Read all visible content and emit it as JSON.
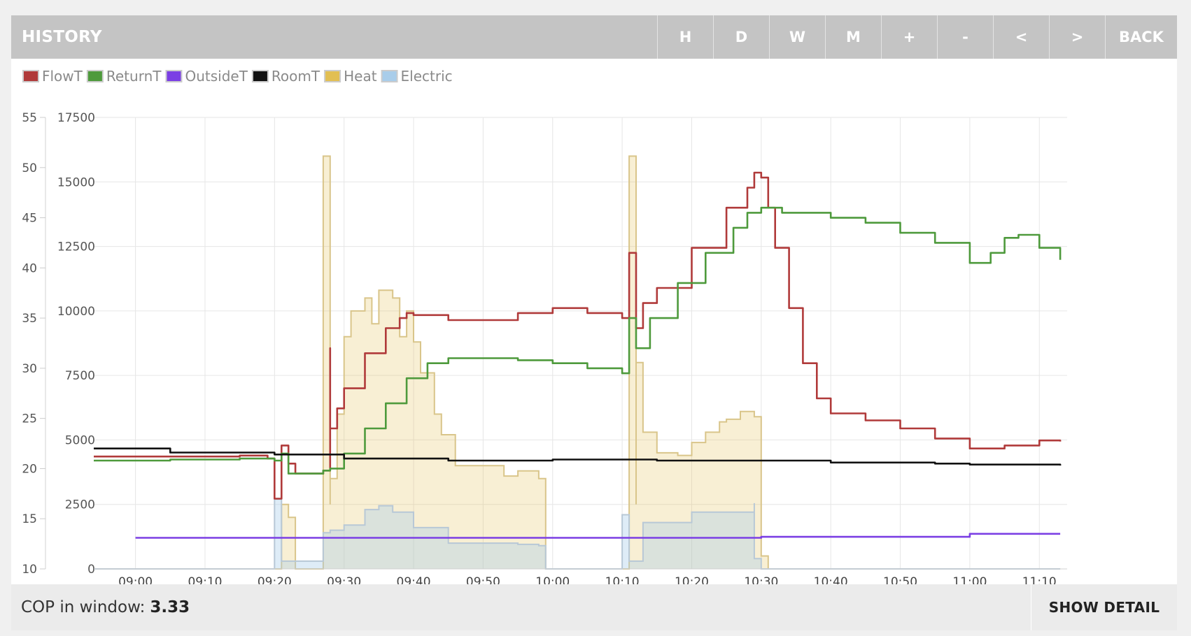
{
  "header": {
    "title": "HISTORY",
    "buttons": {
      "hour": "H",
      "day": "D",
      "week": "W",
      "month": "M",
      "zoom_in": "+",
      "zoom_out": "-",
      "prev": "<",
      "next": ">",
      "back": "BACK"
    }
  },
  "footer": {
    "cop_label": "COP in window:",
    "cop_value": "3.33",
    "detail_label": "SHOW DETAIL"
  },
  "chart_data": {
    "type": "line",
    "x_range": [
      "08:54",
      "11:14"
    ],
    "x_ticks": [
      "09:00",
      "09:10",
      "09:20",
      "09:30",
      "09:40",
      "09:50",
      "10:00",
      "10:10",
      "10:20",
      "10:30",
      "10:40",
      "10:50",
      "11:00",
      "11:10"
    ],
    "y_left": {
      "range": [
        10,
        55
      ],
      "ticks": [
        "10",
        "15",
        "20",
        "25",
        "30",
        "35",
        "40",
        "45",
        "50",
        "55"
      ]
    },
    "y_right": {
      "range": [
        0,
        17500
      ],
      "ticks": [
        "0",
        "2500",
        "5000",
        "7500",
        "10000",
        "12500",
        "15000",
        "17500"
      ]
    },
    "grid": true,
    "legend_position": "top-left",
    "series": [
      {
        "name": "FlowT",
        "axis": "left",
        "color": "#b03a3a",
        "x": [
          "08:54",
          "09:05",
          "09:15",
          "09:19",
          "09:20",
          "09:21",
          "09:22",
          "09:23",
          "09:26",
          "09:27",
          "09:28",
          "09:28",
          "09:29",
          "09:30",
          "09:33",
          "09:36",
          "09:38",
          "09:39",
          "09:40",
          "09:45",
          "09:50",
          "09:55",
          "10:00",
          "10:05",
          "10:10",
          "10:11",
          "10:11",
          "10:12",
          "10:13",
          "10:15",
          "10:20",
          "10:25",
          "10:28",
          "10:29",
          "10:30",
          "10:31",
          "10:32",
          "10:34",
          "10:36",
          "10:38",
          "10:40",
          "10:45",
          "10:50",
          "10:55",
          "11:00",
          "11:05",
          "11:10",
          "11:13"
        ],
        "y": [
          21.2,
          21.2,
          21.3,
          21.0,
          17.0,
          22.3,
          20.5,
          19.5,
          19.5,
          19.8,
          32.0,
          24.0,
          26.0,
          28.0,
          31.5,
          34.0,
          35.0,
          35.5,
          35.3,
          34.8,
          34.8,
          35.5,
          36.0,
          35.5,
          35.0,
          35.0,
          41.5,
          34.0,
          36.5,
          38.0,
          42.0,
          46.0,
          48.0,
          49.5,
          49.0,
          46.0,
          42.0,
          36.0,
          30.5,
          27.0,
          25.5,
          24.8,
          24.0,
          23.0,
          22.0,
          22.3,
          22.8,
          22.7
        ]
      },
      {
        "name": "ReturnT",
        "axis": "left",
        "color": "#4e9a3c",
        "x": [
          "08:54",
          "09:05",
          "09:15",
          "09:20",
          "09:21",
          "09:22",
          "09:24",
          "09:27",
          "09:28",
          "09:30",
          "09:33",
          "09:36",
          "09:39",
          "09:42",
          "09:45",
          "09:50",
          "09:55",
          "10:00",
          "10:05",
          "10:10",
          "10:11",
          "10:12",
          "10:14",
          "10:18",
          "10:22",
          "10:26",
          "10:28",
          "10:30",
          "10:33",
          "10:40",
          "10:45",
          "10:50",
          "10:55",
          "11:00",
          "11:02",
          "11:03",
          "11:05",
          "11:07",
          "11:10",
          "11:13"
        ],
        "y": [
          20.8,
          20.9,
          21.0,
          20.8,
          21.5,
          19.5,
          19.5,
          19.8,
          20.0,
          21.5,
          24.0,
          26.5,
          29.0,
          30.5,
          31.0,
          31.0,
          30.8,
          30.5,
          30.0,
          29.5,
          35.0,
          32.0,
          35.0,
          38.5,
          41.5,
          44.0,
          45.5,
          46.0,
          45.5,
          45.0,
          44.5,
          43.5,
          42.5,
          40.5,
          40.5,
          41.5,
          43.0,
          43.3,
          42.0,
          40.8
        ]
      },
      {
        "name": "OutsideT",
        "axis": "left",
        "color": "#7b3fe4",
        "x": [
          "09:00",
          "10:00",
          "10:30",
          "11:00",
          "11:00",
          "11:13"
        ],
        "y": [
          13.1,
          13.1,
          13.2,
          13.2,
          13.5,
          13.5
        ]
      },
      {
        "name": "RoomT",
        "axis": "left",
        "color": "#111111",
        "x": [
          "08:54",
          "09:05",
          "09:20",
          "09:30",
          "09:45",
          "10:00",
          "10:15",
          "10:30",
          "10:40",
          "10:55",
          "11:00",
          "11:10",
          "11:13"
        ],
        "y": [
          22.0,
          21.6,
          21.4,
          21.0,
          20.8,
          20.9,
          20.8,
          20.8,
          20.6,
          20.5,
          20.4,
          20.4,
          20.3
        ]
      },
      {
        "name": "Heat",
        "axis": "right",
        "color": "#e2bf53",
        "x": [
          "08:54",
          "09:20",
          "09:21",
          "09:22",
          "09:23",
          "09:25",
          "09:27",
          "09:27",
          "09:28",
          "09:28",
          "09:29",
          "09:30",
          "09:31",
          "09:33",
          "09:34",
          "09:35",
          "09:37",
          "09:38",
          "09:39",
          "09:40",
          "09:41",
          "09:43",
          "09:44",
          "09:46",
          "09:50",
          "09:53",
          "09:55",
          "09:58",
          "09:59",
          "10:11",
          "10:11",
          "10:12",
          "10:12",
          "10:13",
          "10:15",
          "10:18",
          "10:20",
          "10:22",
          "10:24",
          "10:25",
          "10:27",
          "10:29",
          "10:30",
          "10:31",
          "11:13"
        ],
        "y": [
          0,
          0,
          2500,
          2000,
          0,
          0,
          0,
          16000,
          2500,
          3500,
          6000,
          9000,
          10000,
          10500,
          9500,
          10800,
          10500,
          9000,
          10000,
          8800,
          7600,
          6000,
          5200,
          4000,
          4000,
          3600,
          3800,
          3500,
          0,
          0,
          16000,
          2500,
          8000,
          5300,
          4500,
          4400,
          4900,
          5300,
          5700,
          5800,
          6100,
          5900,
          500,
          0,
          0
        ]
      },
      {
        "name": "Electric",
        "axis": "right",
        "color": "#a9cdea",
        "x": [
          "08:54",
          "09:20",
          "09:20",
          "09:21",
          "09:24",
          "09:27",
          "09:28",
          "09:30",
          "09:33",
          "09:35",
          "09:37",
          "09:40",
          "09:45",
          "09:55",
          "09:58",
          "09:59",
          "10:08",
          "10:10",
          "10:11",
          "10:11",
          "10:13",
          "10:20",
          "10:29",
          "10:29",
          "10:30",
          "11:13"
        ],
        "y": [
          0,
          0,
          2700,
          300,
          300,
          1400,
          1500,
          1700,
          2300,
          2450,
          2200,
          1600,
          1000,
          950,
          900,
          0,
          0,
          2100,
          1500,
          300,
          1800,
          2200,
          2550,
          400,
          0,
          0
        ]
      }
    ]
  }
}
